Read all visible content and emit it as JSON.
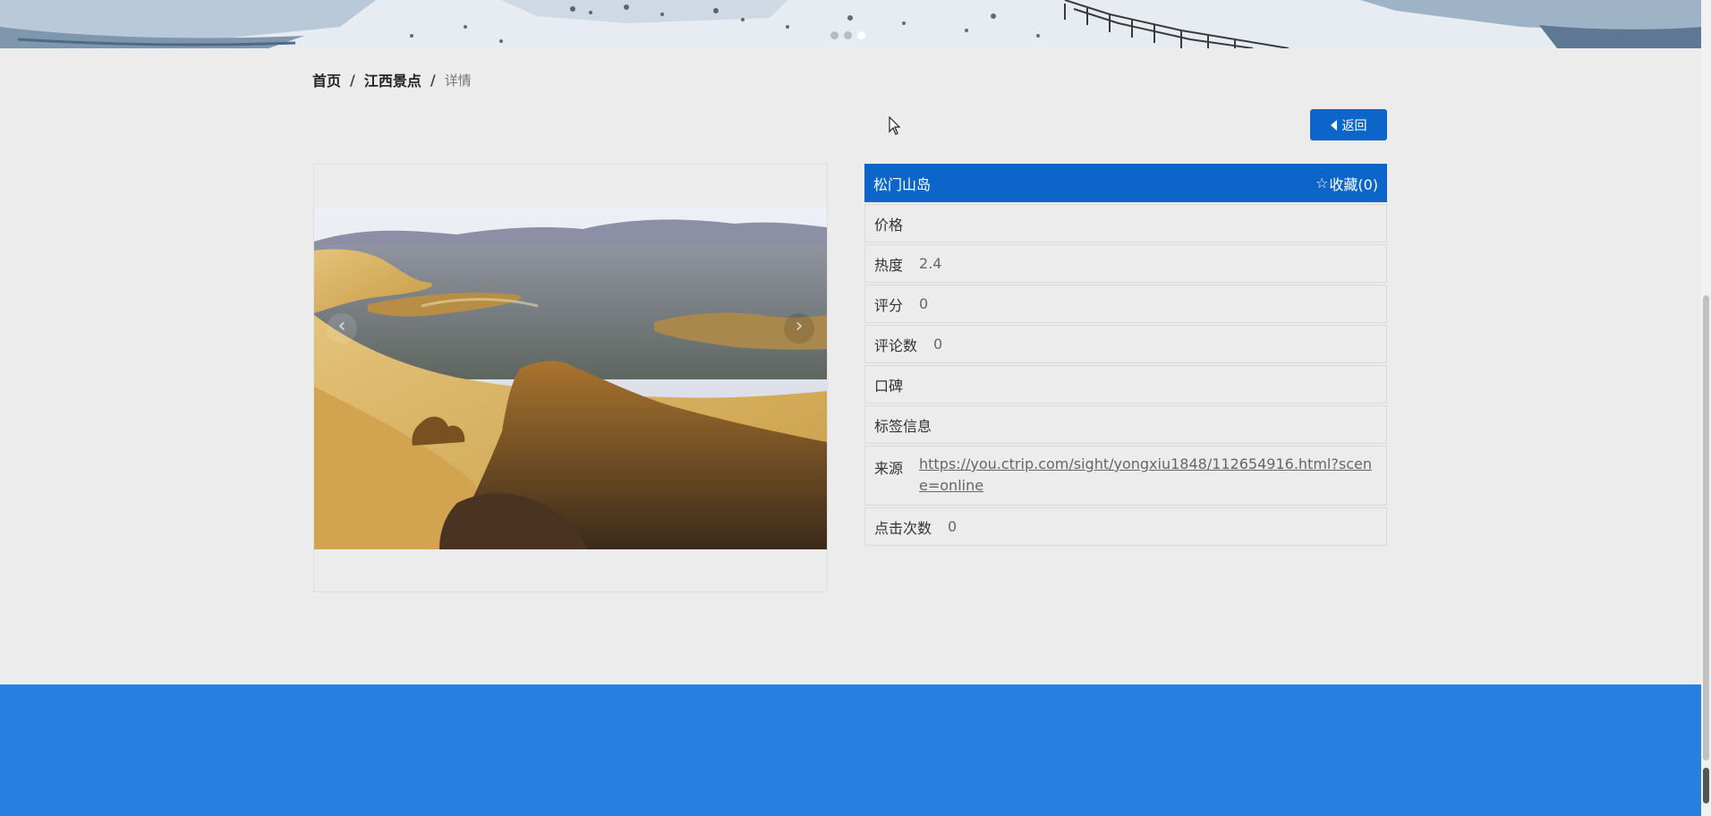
{
  "banner": {
    "dot_count": 3,
    "active_dot": 3
  },
  "breadcrumb": {
    "home": "首页",
    "category": "江西景点",
    "current": "详情",
    "separator": "/"
  },
  "toolbar": {
    "back_label": "返回"
  },
  "gallery": {
    "prev_label": "‹",
    "next_label": "›"
  },
  "detail": {
    "title": "松门山岛",
    "favorite_label": "收藏(0)",
    "star_glyph": "☆",
    "rows": {
      "price": {
        "label": "价格",
        "value": ""
      },
      "heat": {
        "label": "热度",
        "value": "2.4"
      },
      "score": {
        "label": "评分",
        "value": "0"
      },
      "comments": {
        "label": "评论数",
        "value": "0"
      },
      "reputation": {
        "label": "口碑",
        "value": ""
      },
      "tags": {
        "label": "标签信息",
        "value": ""
      },
      "source": {
        "label": "来源",
        "value": "https://you.ctrip.com/sight/yongxiu1848/112654916.html?scene=online"
      },
      "clicks": {
        "label": "点击次数",
        "value": "0"
      }
    }
  },
  "colors": {
    "accent": "#0c66c9",
    "footer": "#2680e0",
    "background": "#ececec"
  }
}
